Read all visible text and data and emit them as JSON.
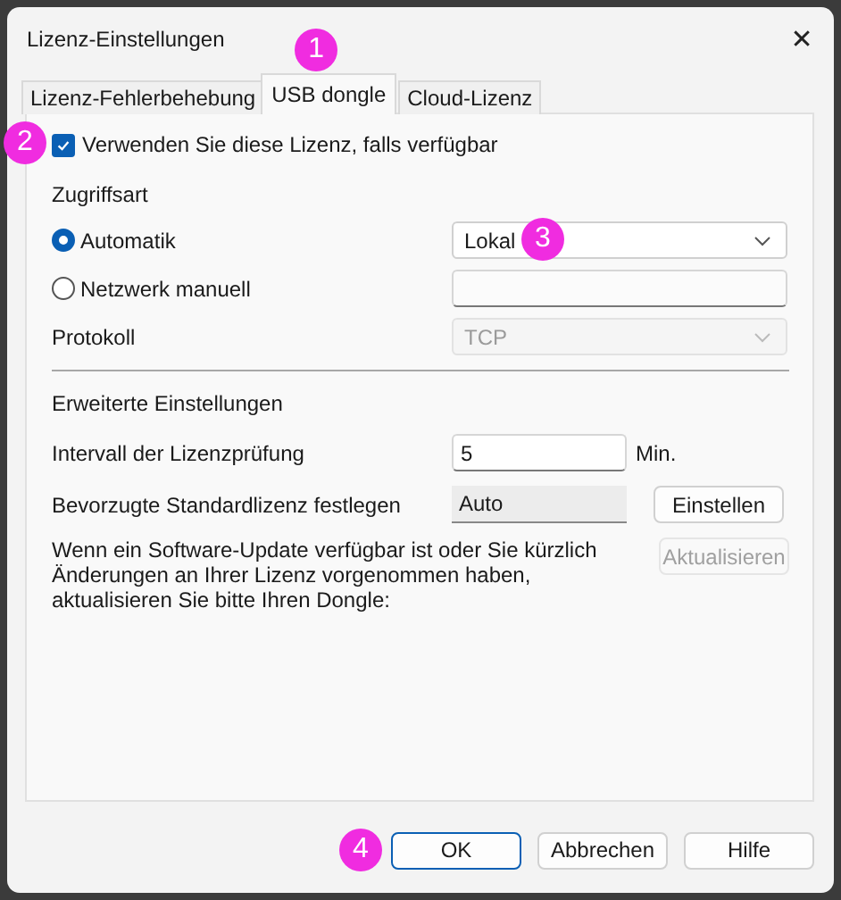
{
  "window": {
    "title": "Lizenz-Einstellungen",
    "close": "✕"
  },
  "tabs": [
    {
      "label": "Lizenz-Fehlerbehebung",
      "selected": false
    },
    {
      "label": "USB dongle",
      "selected": true,
      "callout": "1"
    },
    {
      "label": "Cloud-Lizenz",
      "selected": false
    }
  ],
  "use_license": {
    "label": "Verwenden Sie diese Lizenz, falls verfügbar",
    "checked": true,
    "callout": "2"
  },
  "access": {
    "heading": "Zugriffsart",
    "options": [
      {
        "label": "Automatik",
        "selected": true
      },
      {
        "label": "Netzwerk manuell",
        "selected": false
      }
    ],
    "mode_dropdown": {
      "value": "Lokal",
      "callout": "3"
    },
    "protocol_label": "Protokoll",
    "protocol_dropdown": {
      "value": "TCP",
      "disabled": true
    }
  },
  "advanced": {
    "heading": "Erweiterte Einstellungen",
    "interval_label": "Intervall der Lizenzprüfung",
    "interval_value": "5",
    "interval_unit": "Min.",
    "default_label": "Bevorzugte Standardlizenz festlegen",
    "default_value": "Auto",
    "set_button": "Einstellen",
    "update_text": "Wenn ein Software-Update verfügbar ist oder Sie kürzlich Änderungen an Ihrer Lizenz vorgenommen haben, aktualisieren Sie bitte Ihren Dongle:",
    "update_button": {
      "label": "Aktualisieren",
      "disabled": true
    }
  },
  "buttons": [
    {
      "label": "OK",
      "default": true,
      "callout": "4"
    },
    {
      "label": "Abbrechen",
      "default": false
    },
    {
      "label": "Hilfe",
      "default": false
    }
  ]
}
